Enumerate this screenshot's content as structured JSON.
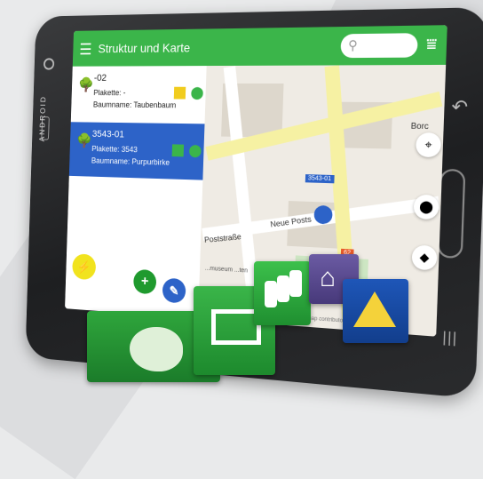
{
  "device": {
    "side_label": "ANDROID"
  },
  "toolbar": {
    "title": "Struktur und Karte",
    "search_placeholder": ""
  },
  "list": {
    "items": [
      {
        "id_label": "-02",
        "plakette": "Plakette: -",
        "baumname": "Baumname: Taubenbaum",
        "color": "#f1cc1e"
      },
      {
        "id_label": "3543-01",
        "plakette": "Plakette: 3543",
        "baumname": "Baumname: Purpurbirke",
        "color": "#3bb54a"
      }
    ]
  },
  "map": {
    "street_1": "Poststraße",
    "street_2": "Neue Posts",
    "street_3": "Borc",
    "marker_label": "3543-01",
    "tag_2": "62",
    "museum": "...museum\n...ten",
    "attribution": "...map contributors, CC-BY-SA, Mapnik"
  },
  "colors": {
    "accent": "#3bb54a",
    "selected": "#2d63c8",
    "fab_yellow": "#f1e31e"
  }
}
